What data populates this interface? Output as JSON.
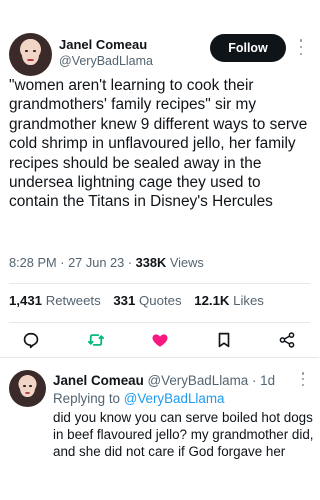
{
  "tweet": {
    "author_name": "Janel Comeau",
    "author_handle": "@VeryBadLlama",
    "follow_label": "Follow",
    "text": "\"women aren't learning to cook their grandmothers' family recipes\" sir my grandmother knew 9 different ways to serve cold shrimp in unflavoured jello, her family recipes should be sealed away in the undersea lightning cage they used to contain the Titans in Disney's Hercules",
    "time": "8:28 PM",
    "date": "27 Jun 23",
    "views_count": "338K",
    "views_label": "Views",
    "separator": "·",
    "retweets_count": "1,431",
    "retweets_label": "Retweets",
    "quotes_count": "331",
    "quotes_label": "Quotes",
    "likes_count": "12.1K",
    "likes_label": "Likes"
  },
  "actions": {
    "reply_icon": "reply-icon",
    "retweet_icon": "retweet-icon",
    "like_icon": "heart-icon",
    "bookmark_icon": "bookmark-icon",
    "share_icon": "share-icon",
    "retweet_color": "#00ba7c",
    "like_color": "#f91880"
  },
  "reply": {
    "author_name": "Janel Comeau",
    "author_handle": "@VeryBadLlama",
    "separator": "·",
    "age": "1d",
    "replying_prefix": "Replying to",
    "replying_handle": "@VeryBadLlama",
    "text": "did you know you can serve boiled hot dogs in beef flavoured jello? my grandmother did, and she did not care if God forgave her"
  }
}
